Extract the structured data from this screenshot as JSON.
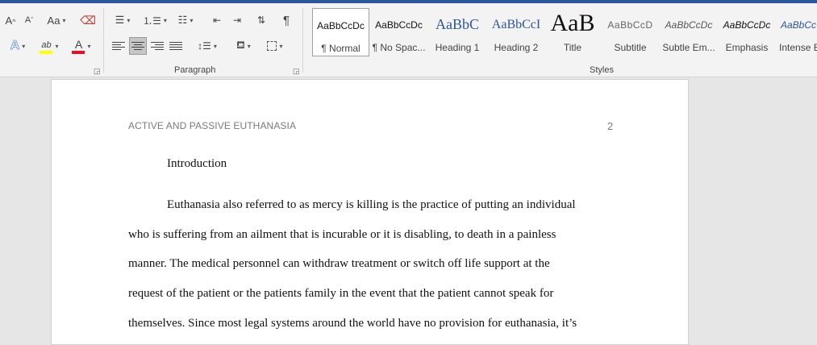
{
  "ribbon": {
    "font": {
      "grow_label": "A",
      "shrink_label": "A",
      "case_label": "Aa",
      "effects_label": "A",
      "highlight_label": "ab",
      "font_color_label": "A",
      "highlight_color": "#ffff00",
      "font_color": "#e81123"
    },
    "paragraph": {
      "group_label": "Paragraph",
      "pilcrow_label": "¶"
    },
    "styles": {
      "group_label": "Styles",
      "items": [
        {
          "preview": "AaBbCcDc",
          "name": "¶ Normal"
        },
        {
          "preview": "AaBbCcDc",
          "name": "¶ No Spac..."
        },
        {
          "preview": "AaBbC",
          "name": "Heading 1"
        },
        {
          "preview": "AaBbCcI",
          "name": "Heading 2"
        },
        {
          "preview": "AaB",
          "name": "Title"
        },
        {
          "preview": "AaBbCcD",
          "name": "Subtitle"
        },
        {
          "preview": "AaBbCcDc",
          "name": "Subtle Em..."
        },
        {
          "preview": "AaBbCcDc",
          "name": "Emphasis"
        },
        {
          "preview": "AaBbCc",
          "name": "Intense E"
        }
      ],
      "heading_color": "#2f5496"
    }
  },
  "document": {
    "running_head": "ACTIVE AND PASSIVE EUTHANASIA",
    "page_number": "2",
    "heading": "Introduction",
    "lines": [
      "Euthanasia also referred to as mercy is killing is the practice of putting an individual",
      "who is suffering from an ailment that is incurable or it is disabling, to death in a painless",
      "manner. The medical personnel can withdraw treatment or switch off life support at the",
      "request of the patient or the patients family in the event that the patient cannot speak for",
      "themselves.  Since most legal systems around the world have no provision for euthanasia, it’s"
    ]
  }
}
